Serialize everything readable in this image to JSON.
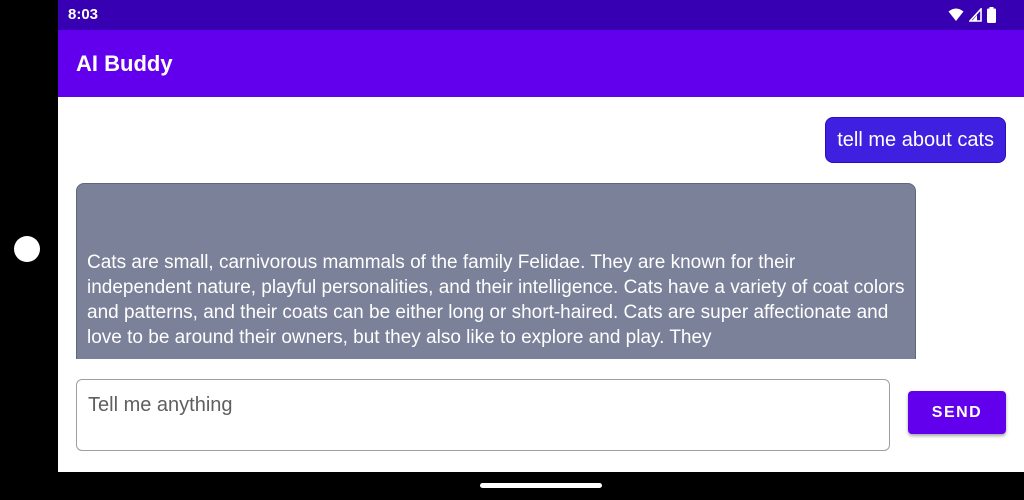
{
  "status_bar": {
    "time": "8:03",
    "icons": [
      "wifi-icon",
      "cellular-signal-icon",
      "battery-icon"
    ]
  },
  "app_bar": {
    "title": "AI Buddy"
  },
  "chat": {
    "messages": [
      {
        "sender": "user",
        "text": "tell me about cats"
      },
      {
        "sender": "assistant",
        "text": "Cats are small, carnivorous mammals of the family Felidae. They are known for their independent nature, playful personalities, and their intelligence. Cats have a variety of coat colors and patterns, and their coats can be either long or short-haired. Cats are super affectionate and love to be around their owners, but they also like to explore and play. They"
      }
    ]
  },
  "composer": {
    "placeholder": "Tell me anything",
    "value": "",
    "send_label": "SEND"
  },
  "colors": {
    "status_bar": "#3700b3",
    "app_bar": "#6200ee",
    "user_bubble": "#3f1fe0",
    "assistant_bubble": "#7a8199",
    "send_button": "#6200ee"
  }
}
